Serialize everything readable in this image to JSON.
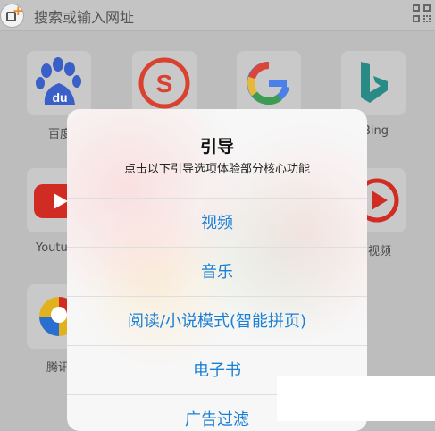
{
  "topbar": {
    "search_placeholder": "搜索或输入网址"
  },
  "shortcuts": [
    {
      "label": "百度",
      "icon": "baidu-icon"
    },
    {
      "label": "",
      "icon": "sogou-icon"
    },
    {
      "label": "",
      "icon": "google-icon"
    },
    {
      "label": "Bing",
      "icon": "bing-icon"
    },
    {
      "label": "Youtube",
      "icon": "youtube-icon"
    },
    {
      "label": "视频",
      "icon": "video-icon"
    },
    {
      "label": "腾讯",
      "icon": "tencent-icon"
    }
  ],
  "dialog": {
    "title": "引导",
    "subtitle": "点击以下引导选项体验部分核心功能",
    "options": [
      "视频",
      "音乐",
      "阅读/小说模式(智能拼页)",
      "电子书",
      "广告过滤"
    ]
  },
  "colors": {
    "accent": "#1a7fd6",
    "tab_plus": "#f08a24"
  }
}
